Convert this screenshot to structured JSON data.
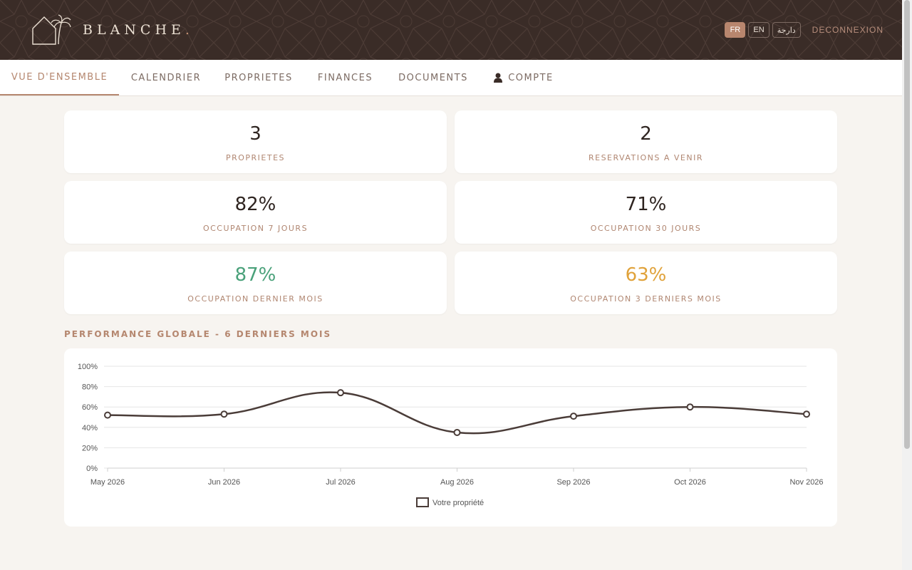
{
  "brand": {
    "name": "BLANCHE",
    "dot": "."
  },
  "header": {
    "languages": [
      "FR",
      "EN",
      "دارجة"
    ],
    "active_language": "FR",
    "logout": "DECONNEXION"
  },
  "nav": {
    "tabs": [
      {
        "label": "VUE D'ENSEMBLE",
        "active": true
      },
      {
        "label": "CALENDRIER",
        "active": false
      },
      {
        "label": "PROPRIETES",
        "active": false
      },
      {
        "label": "FINANCES",
        "active": false
      },
      {
        "label": "DOCUMENTS",
        "active": false
      },
      {
        "label": "COMPTE",
        "active": false,
        "icon": "user-icon"
      }
    ]
  },
  "stats": [
    {
      "value": "3",
      "label": "PROPRIETES"
    },
    {
      "value": "2",
      "label": "RESERVATIONS A VENIR"
    },
    {
      "value": "82%",
      "label": "OCCUPATION 7 JOURS"
    },
    {
      "value": "71%",
      "label": "OCCUPATION 30 JOURS"
    },
    {
      "value": "87%",
      "label": "OCCUPATION DERNIER MOIS",
      "color": "#4aa17a"
    },
    {
      "value": "63%",
      "label": "OCCUPATION 3 DERNIERS MOIS",
      "color": "#e0a23a"
    }
  ],
  "section_title": "PERFORMANCE GLOBALE - 6 DERNIERS MOIS",
  "colors": {
    "accent": "#b5876f",
    "header_bg": "#3a2c27",
    "line": "#4a3c38"
  },
  "chart_data": {
    "type": "line",
    "categories": [
      "May 2026",
      "Jun 2026",
      "Jul 2026",
      "Aug 2026",
      "Sep 2026",
      "Oct 2026",
      "Nov 2026"
    ],
    "series": [
      {
        "name": "Votre propriété",
        "values": [
          52,
          53,
          74,
          35,
          51,
          60,
          53
        ]
      }
    ],
    "y_ticks": [
      "0%",
      "20%",
      "40%",
      "60%",
      "80%",
      "100%"
    ],
    "ylim": [
      0,
      100
    ],
    "grid": true,
    "legend": "bottom"
  }
}
